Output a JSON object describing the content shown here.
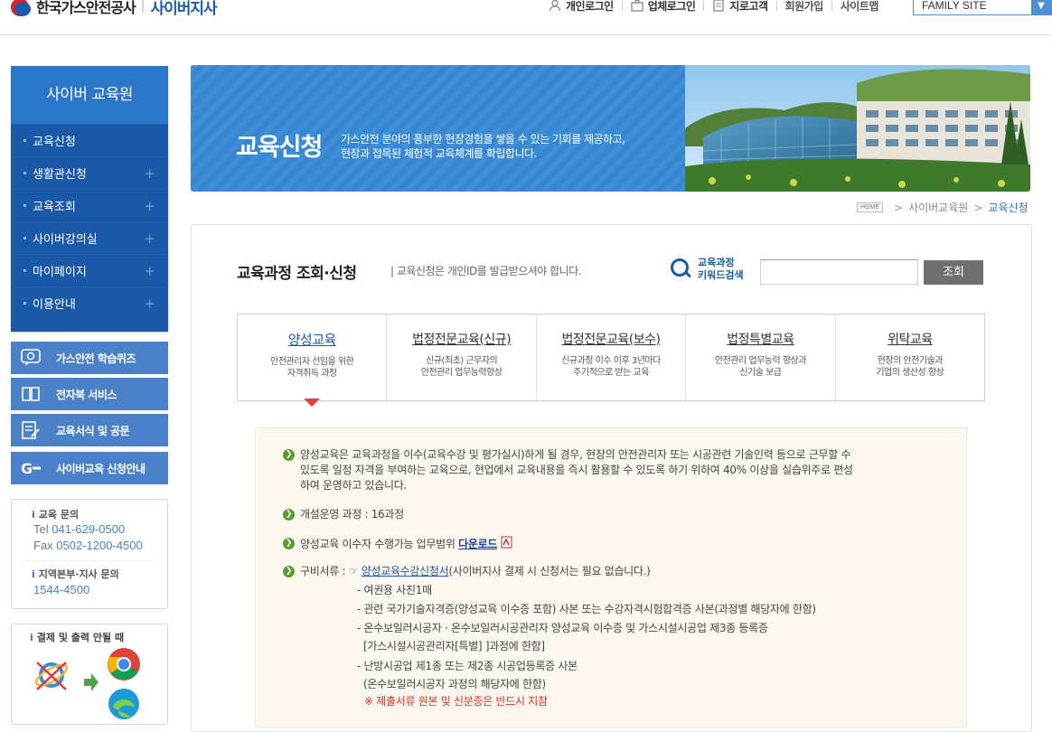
{
  "header": {
    "org": "한국가스안전공사",
    "site": "사이버지사",
    "gnb": [
      {
        "label": "개인로그인",
        "icon": "person-icon"
      },
      {
        "label": "업체로그인",
        "icon": "briefcase-icon"
      },
      {
        "label": "지로고객",
        "icon": "document-icon"
      },
      {
        "label": "회원가입"
      },
      {
        "label": "사이트맵"
      }
    ],
    "family_site": "FAMILY SITE"
  },
  "sidebar": {
    "title": "사이버 교육원",
    "items": [
      {
        "label": "교육신청"
      },
      {
        "label": "생활관신청",
        "plus": "+"
      },
      {
        "label": "교육조회",
        "plus": "+"
      },
      {
        "label": "사이버강의실",
        "plus": "+"
      },
      {
        "label": "마이페이지",
        "plus": "+"
      },
      {
        "label": "이용안내",
        "plus": "+"
      }
    ],
    "quick": [
      {
        "label": "가스안전 학습퀴즈",
        "icon": "quiz-icon"
      },
      {
        "label": "전자북 서비스",
        "icon": "book-icon"
      },
      {
        "label": "교육서식 및 공문",
        "icon": "form-icon"
      },
      {
        "label": "사이버교육 신청안내",
        "icon": "g-icon"
      }
    ],
    "contact": {
      "edu_title": "교육 문의",
      "tel_label": "Tel",
      "tel": "041-629-0500",
      "fax_label": "Fax",
      "fax": "0502-1200-4500",
      "region_title": "지역본부·지사 문의",
      "region_tel": "1544-4500"
    },
    "browser_title": "결제 및 출력 안될 때"
  },
  "banner": {
    "title": "교육신청",
    "desc_line1": "가스안전 분야의 풍부한 현장경험을 쌓을 수 있는 기회를 제공하고,",
    "desc_line2": "현장과 접목된 체험적 교육체계를 확립합니다."
  },
  "breadcrumb": {
    "home": "HOME",
    "sep": ">",
    "level1": "사이버교육원",
    "current": "교육신청"
  },
  "main": {
    "title": "교육과정 조회·신청",
    "subtitle": "| 교육신청은 개인ID를 발급받으셔야 합니다.",
    "search_label_1": "교육과정",
    "search_label_2": "키워드검색",
    "search_value": "",
    "search_button": "조회",
    "tabs": [
      {
        "name": "양성교육",
        "desc1": "안전관리자 선임을 위한",
        "desc2": "자격취득 과정"
      },
      {
        "name": "법정전문교육(신규)",
        "desc1": "신규(최초) 근무자의",
        "desc2": "안전관리 업무능력향상"
      },
      {
        "name": "법정전문교육(보수)",
        "desc1": "신규과정 이수 이후 3년마다",
        "desc2": "주기적으로 받는 교육"
      },
      {
        "name": "법정특별교육",
        "desc1": "안전관리 업무능력 향상과",
        "desc2": "신기술 보급"
      },
      {
        "name": "위탁교육",
        "desc1": "현장의 안전기술과",
        "desc2": "기업의 생산성 향상"
      }
    ],
    "info": {
      "p1_line1": "양성교육은 교육과정을 이수(교육수강 및 평가실시)하게 될 경우, 현장의 안전관리자 또는 시공관련 기술인력 등으로 근무할 수",
      "p1_line2": "있도록 일정 자격을 부여하는 교육으로, 현업에서 교육내용을 즉시 활용할 수 있도록 하기 위하여 40% 이상을 실습위주로 편성",
      "p1_line3": "하여 운영하고 있습니다.",
      "p2": "개설운영 과정 : 16과정",
      "p3_text": "양성교육 이수자 수행가능 업무범위",
      "p3_link": "다운로드",
      "p4_label": "구비서류 :",
      "p4_link": "양성교육수강신청서",
      "p4_note": "(사이버지사 결제 시 신청서는 필요 없습니다.)",
      "docs": [
        "- 여권용 사진1매",
        "- 관련 국가기술자격증(양성교육 이수증 포함) 사본 또는 수강자격시험합격증 사본(과정별 해당자에 한함)",
        "- 온수보일러시공자 · 온수보일러시공관리자 양성교육 이수증 및 가스시설시공업 제3종 등록증",
        "  [가스시설시공관리자[특별] ]과정에 한함]",
        "- 난방시공업 제1종 또는 제2종 시공업등록증 사본",
        "  (온수보일러시공자 과정의 해당자에 한함)"
      ],
      "warning": "※ 제출서류 원본 및 신분증은 반드시 지참"
    }
  }
}
